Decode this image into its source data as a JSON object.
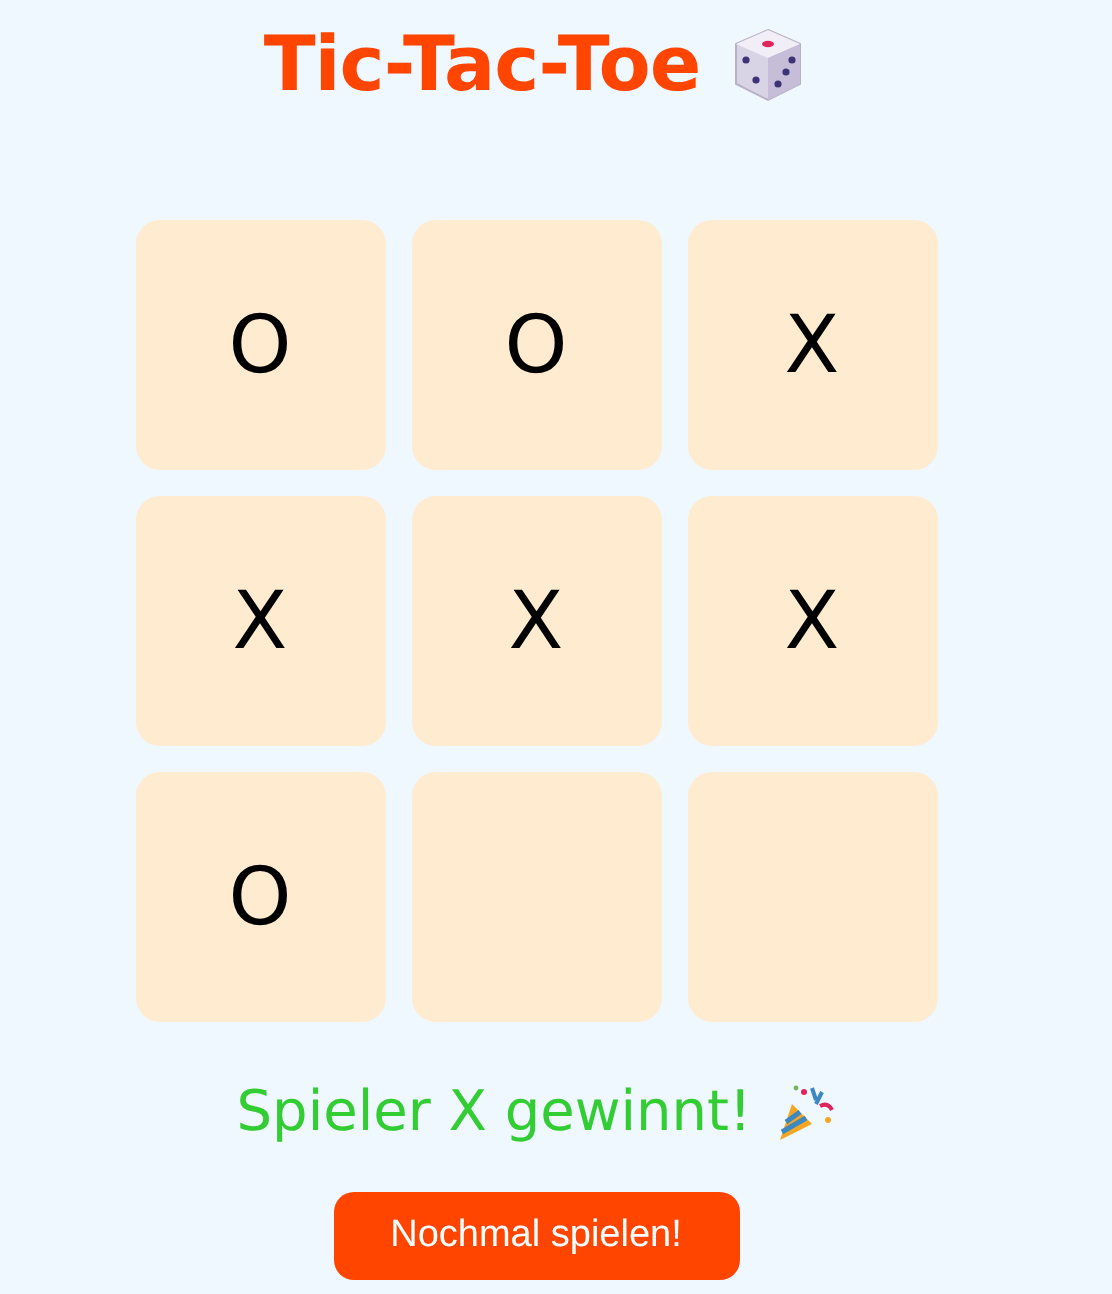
{
  "title": "Tic-Tac-Toe",
  "board": [
    {
      "kind": "taken",
      "mark": "O"
    },
    {
      "kind": "taken",
      "mark": "O"
    },
    {
      "kind": "taken",
      "mark": "X"
    },
    {
      "kind": "taken",
      "mark": "X"
    },
    {
      "kind": "taken",
      "mark": "X"
    },
    {
      "kind": "taken",
      "mark": "X"
    },
    {
      "kind": "taken",
      "mark": "O"
    },
    {
      "kind": "free"
    },
    {
      "kind": "free"
    }
  ],
  "status": "Spieler X gewinnt!",
  "button": "Nochmal spielen!"
}
